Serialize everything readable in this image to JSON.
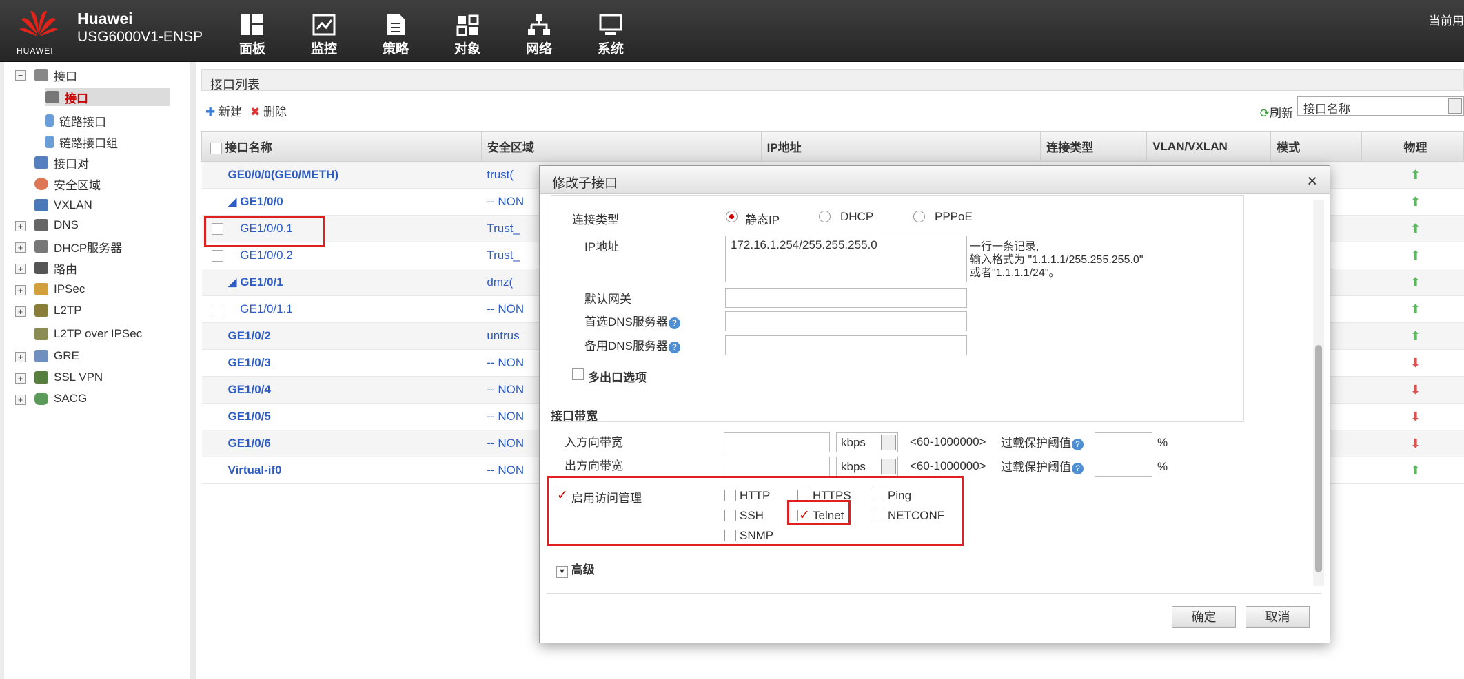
{
  "header": {
    "brand": "Huawei",
    "model": "USG6000V1-ENSP",
    "logo_text": "HUAWEI",
    "corner_text": "当前用",
    "nav": [
      {
        "label": "面板",
        "icon": "dashboard-icon"
      },
      {
        "label": "监控",
        "icon": "monitor-icon"
      },
      {
        "label": "策略",
        "icon": "policy-icon"
      },
      {
        "label": "对象",
        "icon": "object-icon"
      },
      {
        "label": "网络",
        "icon": "network-icon"
      },
      {
        "label": "系统",
        "icon": "system-icon"
      }
    ]
  },
  "tree": [
    {
      "label": "接口"
    },
    {
      "label": "接口"
    },
    {
      "label": "链路接口"
    },
    {
      "label": "链路接口组"
    },
    {
      "label": "接口对"
    },
    {
      "label": "安全区域"
    },
    {
      "label": "VXLAN"
    },
    {
      "label": "DNS"
    },
    {
      "label": "DHCP服务器"
    },
    {
      "label": "路由"
    },
    {
      "label": "IPSec"
    },
    {
      "label": "L2TP"
    },
    {
      "label": "L2TP over IPSec"
    },
    {
      "label": "GRE"
    },
    {
      "label": "SSL VPN"
    },
    {
      "label": "SACG"
    }
  ],
  "main": {
    "title": "接口列表",
    "new": "新建",
    "delete": "删除",
    "refresh": "刷新",
    "filter": "接口名称",
    "columns": [
      "接口名称",
      "安全区域",
      "IP地址",
      "连接类型",
      "VLAN/VXLAN",
      "模式",
      "物理"
    ],
    "rows": [
      {
        "name": "GE0/0/0(GE0/METH)",
        "zone": "trust(",
        "state": "up"
      },
      {
        "name": "GE1/0/0",
        "zone": "-- NON",
        "state": "up"
      },
      {
        "name": "GE1/0/0.1",
        "zone": "Trust_",
        "state": "up"
      },
      {
        "name": "GE1/0/0.2",
        "zone": "Trust_",
        "state": "up"
      },
      {
        "name": "GE1/0/1",
        "zone": "dmz(",
        "state": "up"
      },
      {
        "name": "GE1/0/1.1",
        "zone": "-- NON",
        "state": "up"
      },
      {
        "name": "GE1/0/2",
        "zone": "untrus",
        "state": "up"
      },
      {
        "name": "GE1/0/3",
        "zone": "-- NON",
        "state": "down"
      },
      {
        "name": "GE1/0/4",
        "zone": "-- NON",
        "state": "down"
      },
      {
        "name": "GE1/0/5",
        "zone": "-- NON",
        "state": "down"
      },
      {
        "name": "GE1/0/6",
        "zone": "-- NON",
        "state": "down"
      },
      {
        "name": "Virtual-if0",
        "zone": "-- NON",
        "state": "up"
      }
    ]
  },
  "dialog": {
    "title": "修改子接口",
    "conn_type_label": "连接类型",
    "static_ip": "静态IP",
    "dhcp": "DHCP",
    "pppoe": "PPPoE",
    "ip_label": "IP地址",
    "ip_value": "172.16.1.254/255.255.255.0",
    "ip_help": [
      "一行一条记录,",
      "输入格式为 \"1.1.1.1/255.255.255.0\"",
      "或者\"1.1.1.1/24\"。"
    ],
    "gateway_label": "默认网关",
    "dns1_label": "首选DNS服务器",
    "dns2_label": "备用DNS服务器",
    "multi_exit": "多出口选项",
    "bandwidth_title": "接口带宽",
    "in_bw": "入方向带宽",
    "out_bw": "出方向带宽",
    "unit": "kbps",
    "range": "<60-1000000>",
    "threshold": "过载保护阈值",
    "percent": "%",
    "access_mgmt": "启用访问管理",
    "http": "HTTP",
    "https": "HTTPS",
    "ping": "Ping",
    "ssh": "SSH",
    "telnet": "Telnet",
    "netconf": "NETCONF",
    "snmp": "SNMP",
    "advanced": "高级",
    "ok": "确定",
    "cancel": "取消",
    "question": "?"
  }
}
